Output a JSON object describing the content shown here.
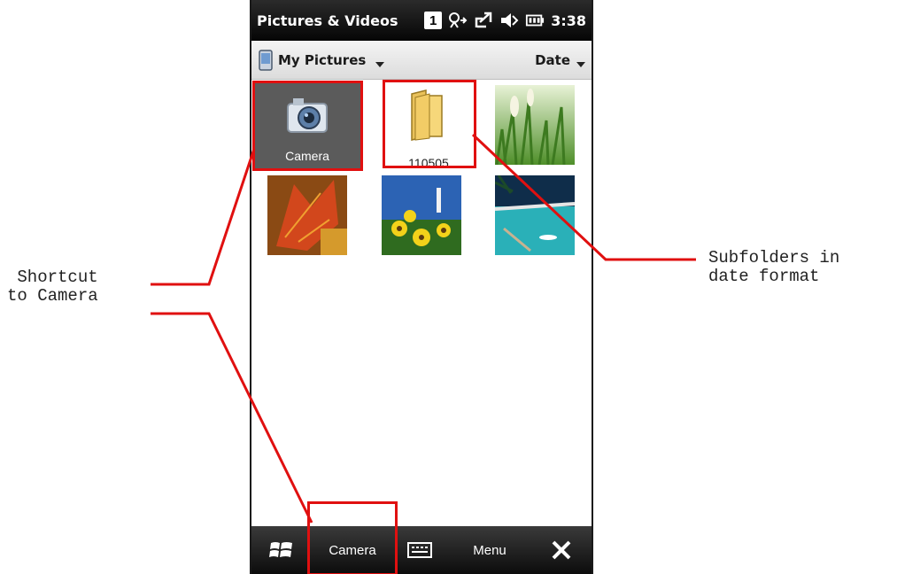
{
  "statusbar": {
    "app_title": "Pictures & Videos",
    "notification_count": "1",
    "time": "3:38",
    "icons": [
      "connectivity-icon",
      "sync-icon",
      "speaker-muted-icon",
      "battery-icon"
    ]
  },
  "navbar": {
    "location_label": "My Pictures",
    "sort_label": "Date"
  },
  "grid": {
    "items": [
      {
        "type": "shortcut",
        "label": "Camera",
        "icon": "camera-icon"
      },
      {
        "type": "folder",
        "label": "110505",
        "icon": "folder-icon"
      },
      {
        "type": "photo",
        "subject": "grass"
      },
      {
        "type": "photo",
        "subject": "autumn-leaf"
      },
      {
        "type": "photo",
        "subject": "yellow-flowers-lighthouse"
      },
      {
        "type": "photo",
        "subject": "beach-pier"
      }
    ]
  },
  "taskbar": {
    "start_icon": "windows-flag-icon",
    "camera_label": "Camera",
    "keyboard_icon": "keyboard-icon",
    "menu_label": "Menu",
    "close_icon": "close-icon"
  },
  "annotations": {
    "left_line1": " Shortcut",
    "left_line2": "to Camera",
    "right_line1": "Subfolders in",
    "right_line2": "date format"
  },
  "colors": {
    "highlight": "#e01010",
    "camera_tile_bg": "#5b5b5b"
  }
}
